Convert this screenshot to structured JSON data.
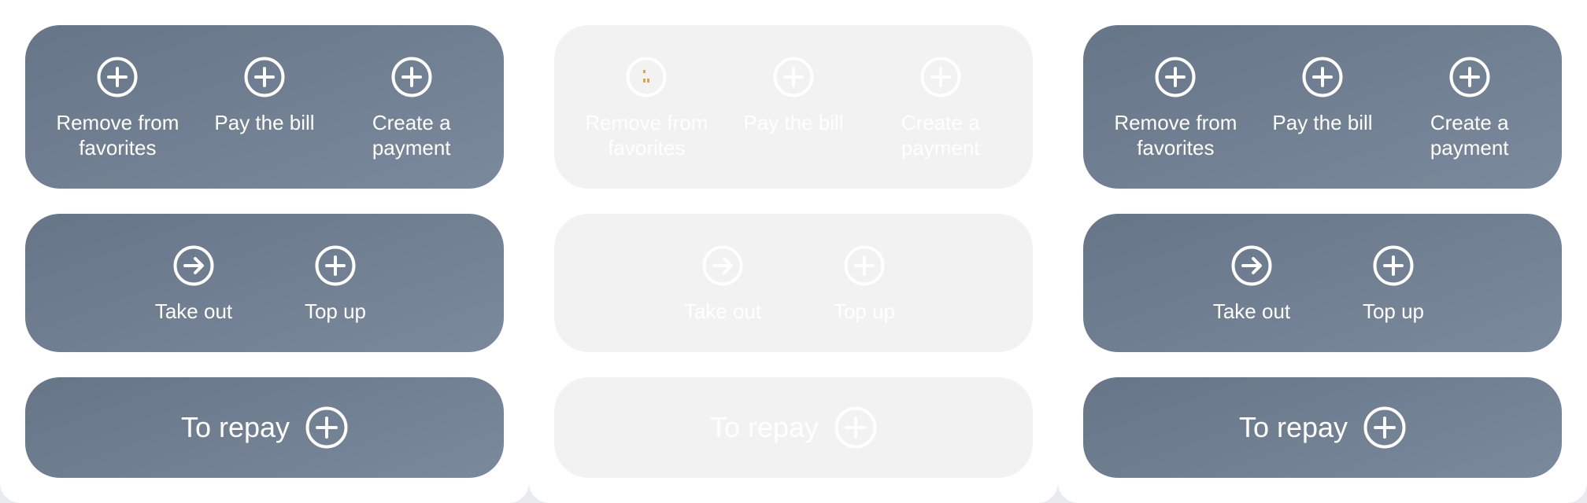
{
  "cards": {
    "favorites_actions": [
      {
        "label": "Remove from\nfavorites",
        "icon": "plus-circle-icon"
      },
      {
        "label": "Pay the bill",
        "icon": "plus-circle-icon"
      },
      {
        "label": "Create a\npayment",
        "icon": "plus-circle-icon"
      }
    ],
    "wallet_actions": [
      {
        "label": "Take out",
        "icon": "arrow-right-circle-icon"
      },
      {
        "label": "Top up",
        "icon": "plus-circle-icon"
      }
    ],
    "repay": {
      "label": "To repay",
      "icon": "plus-circle-icon"
    }
  },
  "variants": [
    "default",
    "disabled",
    "default"
  ],
  "colors": {
    "card_dark_start": "#667587",
    "card_dark_end": "#7b899c",
    "card_disabled": "#f2f2f2",
    "foreground": "#ffffff"
  }
}
